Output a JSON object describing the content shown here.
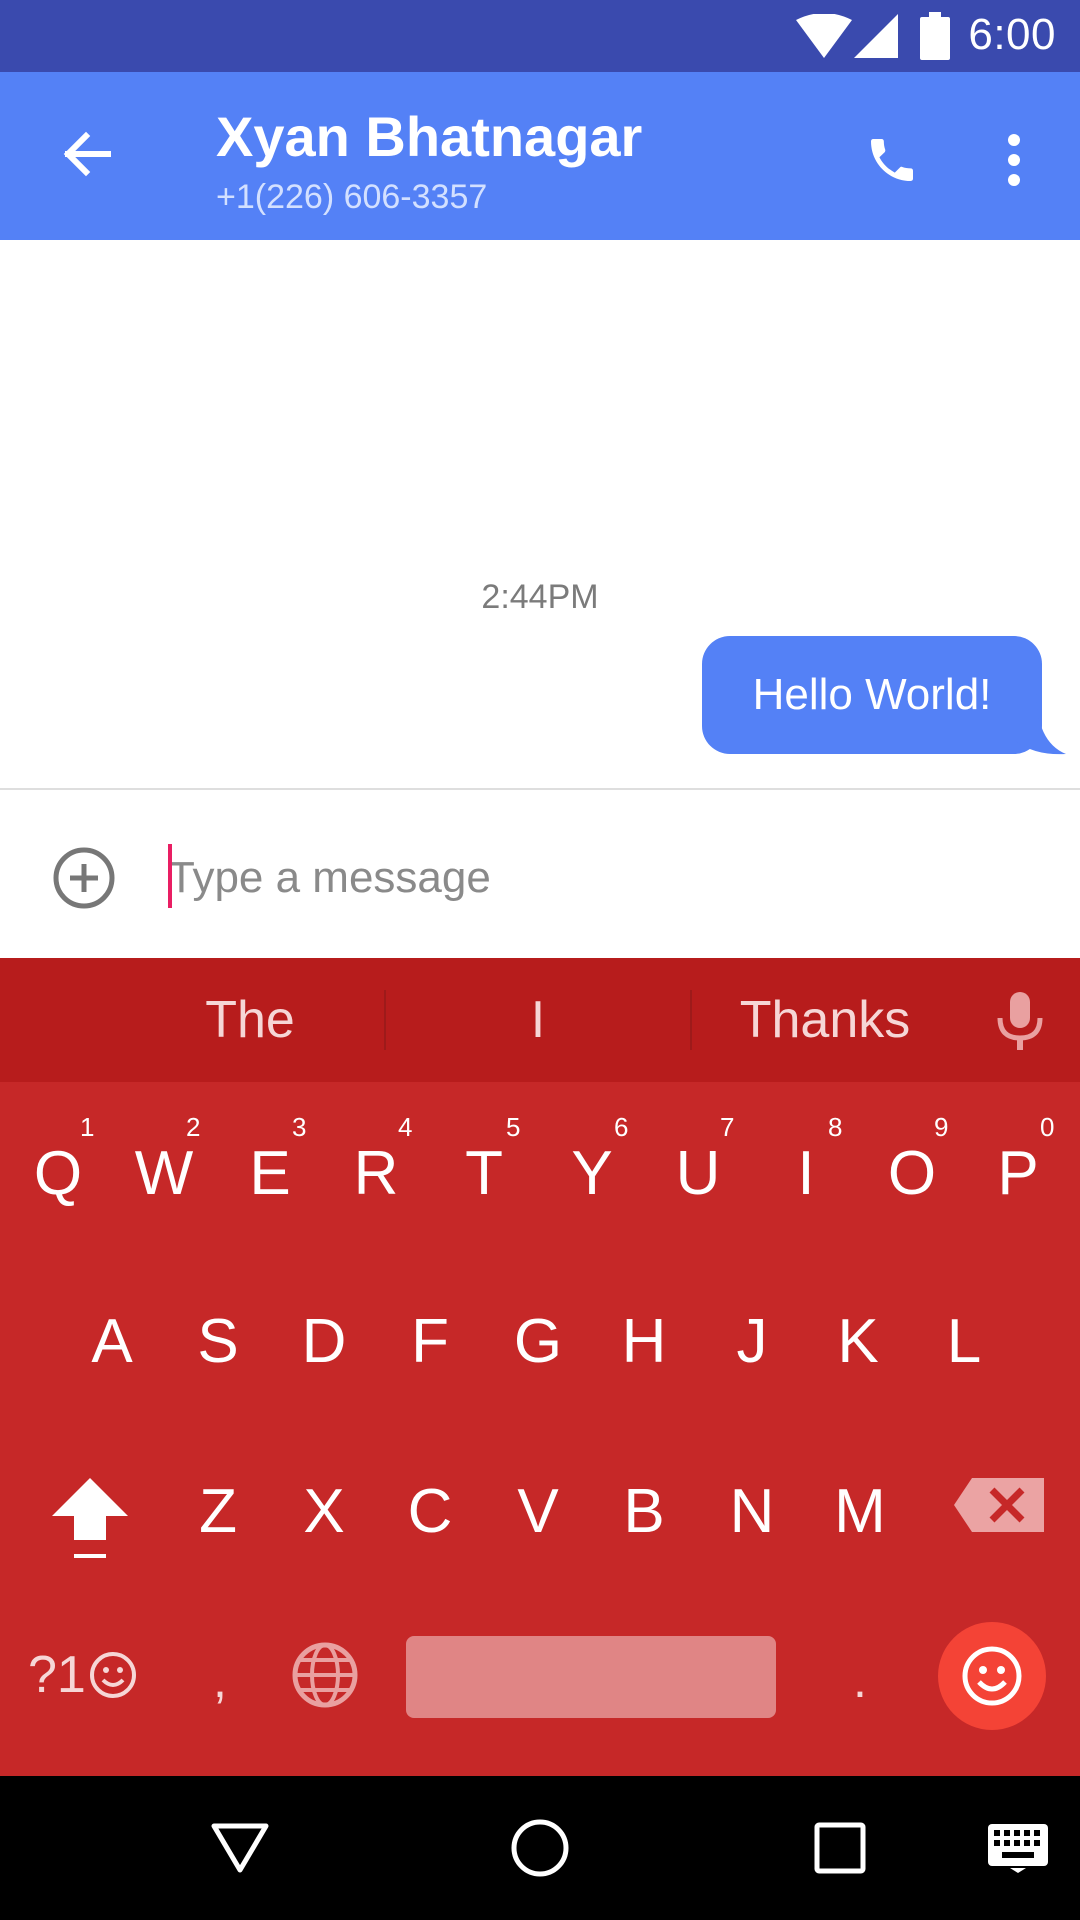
{
  "status_bar": {
    "time": "6:00",
    "icons": [
      "wifi-icon",
      "signal-icon",
      "battery-icon"
    ]
  },
  "app_bar": {
    "contact_name": "Xyan Bhatnagar",
    "contact_phone": "+1(226) 606-3357",
    "icons": [
      "back-arrow-icon",
      "phone-icon",
      "more-vert-icon"
    ]
  },
  "conversation": {
    "timestamp": "2:44PM",
    "messages": [
      {
        "text": "Hello World!",
        "direction": "outgoing"
      }
    ]
  },
  "compose": {
    "placeholder": "Type a message",
    "value": "",
    "attach_icon": "add-circle-icon"
  },
  "keyboard": {
    "suggestions": [
      "The",
      "I",
      "Thanks"
    ],
    "row1": [
      {
        "key": "Q",
        "hint": "1"
      },
      {
        "key": "W",
        "hint": "2"
      },
      {
        "key": "E",
        "hint": "3"
      },
      {
        "key": "R",
        "hint": "4"
      },
      {
        "key": "T",
        "hint": "5"
      },
      {
        "key": "Y",
        "hint": "6"
      },
      {
        "key": "U",
        "hint": "7"
      },
      {
        "key": "I",
        "hint": "8"
      },
      {
        "key": "O",
        "hint": "9"
      },
      {
        "key": "P",
        "hint": "0"
      }
    ],
    "row2": [
      "A",
      "S",
      "D",
      "F",
      "G",
      "H",
      "J",
      "K",
      "L"
    ],
    "row3": [
      "Z",
      "X",
      "C",
      "V",
      "B",
      "N",
      "M"
    ],
    "symbols_label": "?1",
    "comma": ",",
    "period": ".",
    "colors": {
      "keyboard_bg": "#C62828",
      "suggestion_bg": "#B71C1C",
      "emoji_button": "#F44336",
      "space_bar": "#E08585"
    }
  },
  "colors": {
    "status_bar": "#3A4AAE",
    "app_bar": "#5481F6",
    "bubble": "#5481F6",
    "cursor": "#E91E63"
  }
}
